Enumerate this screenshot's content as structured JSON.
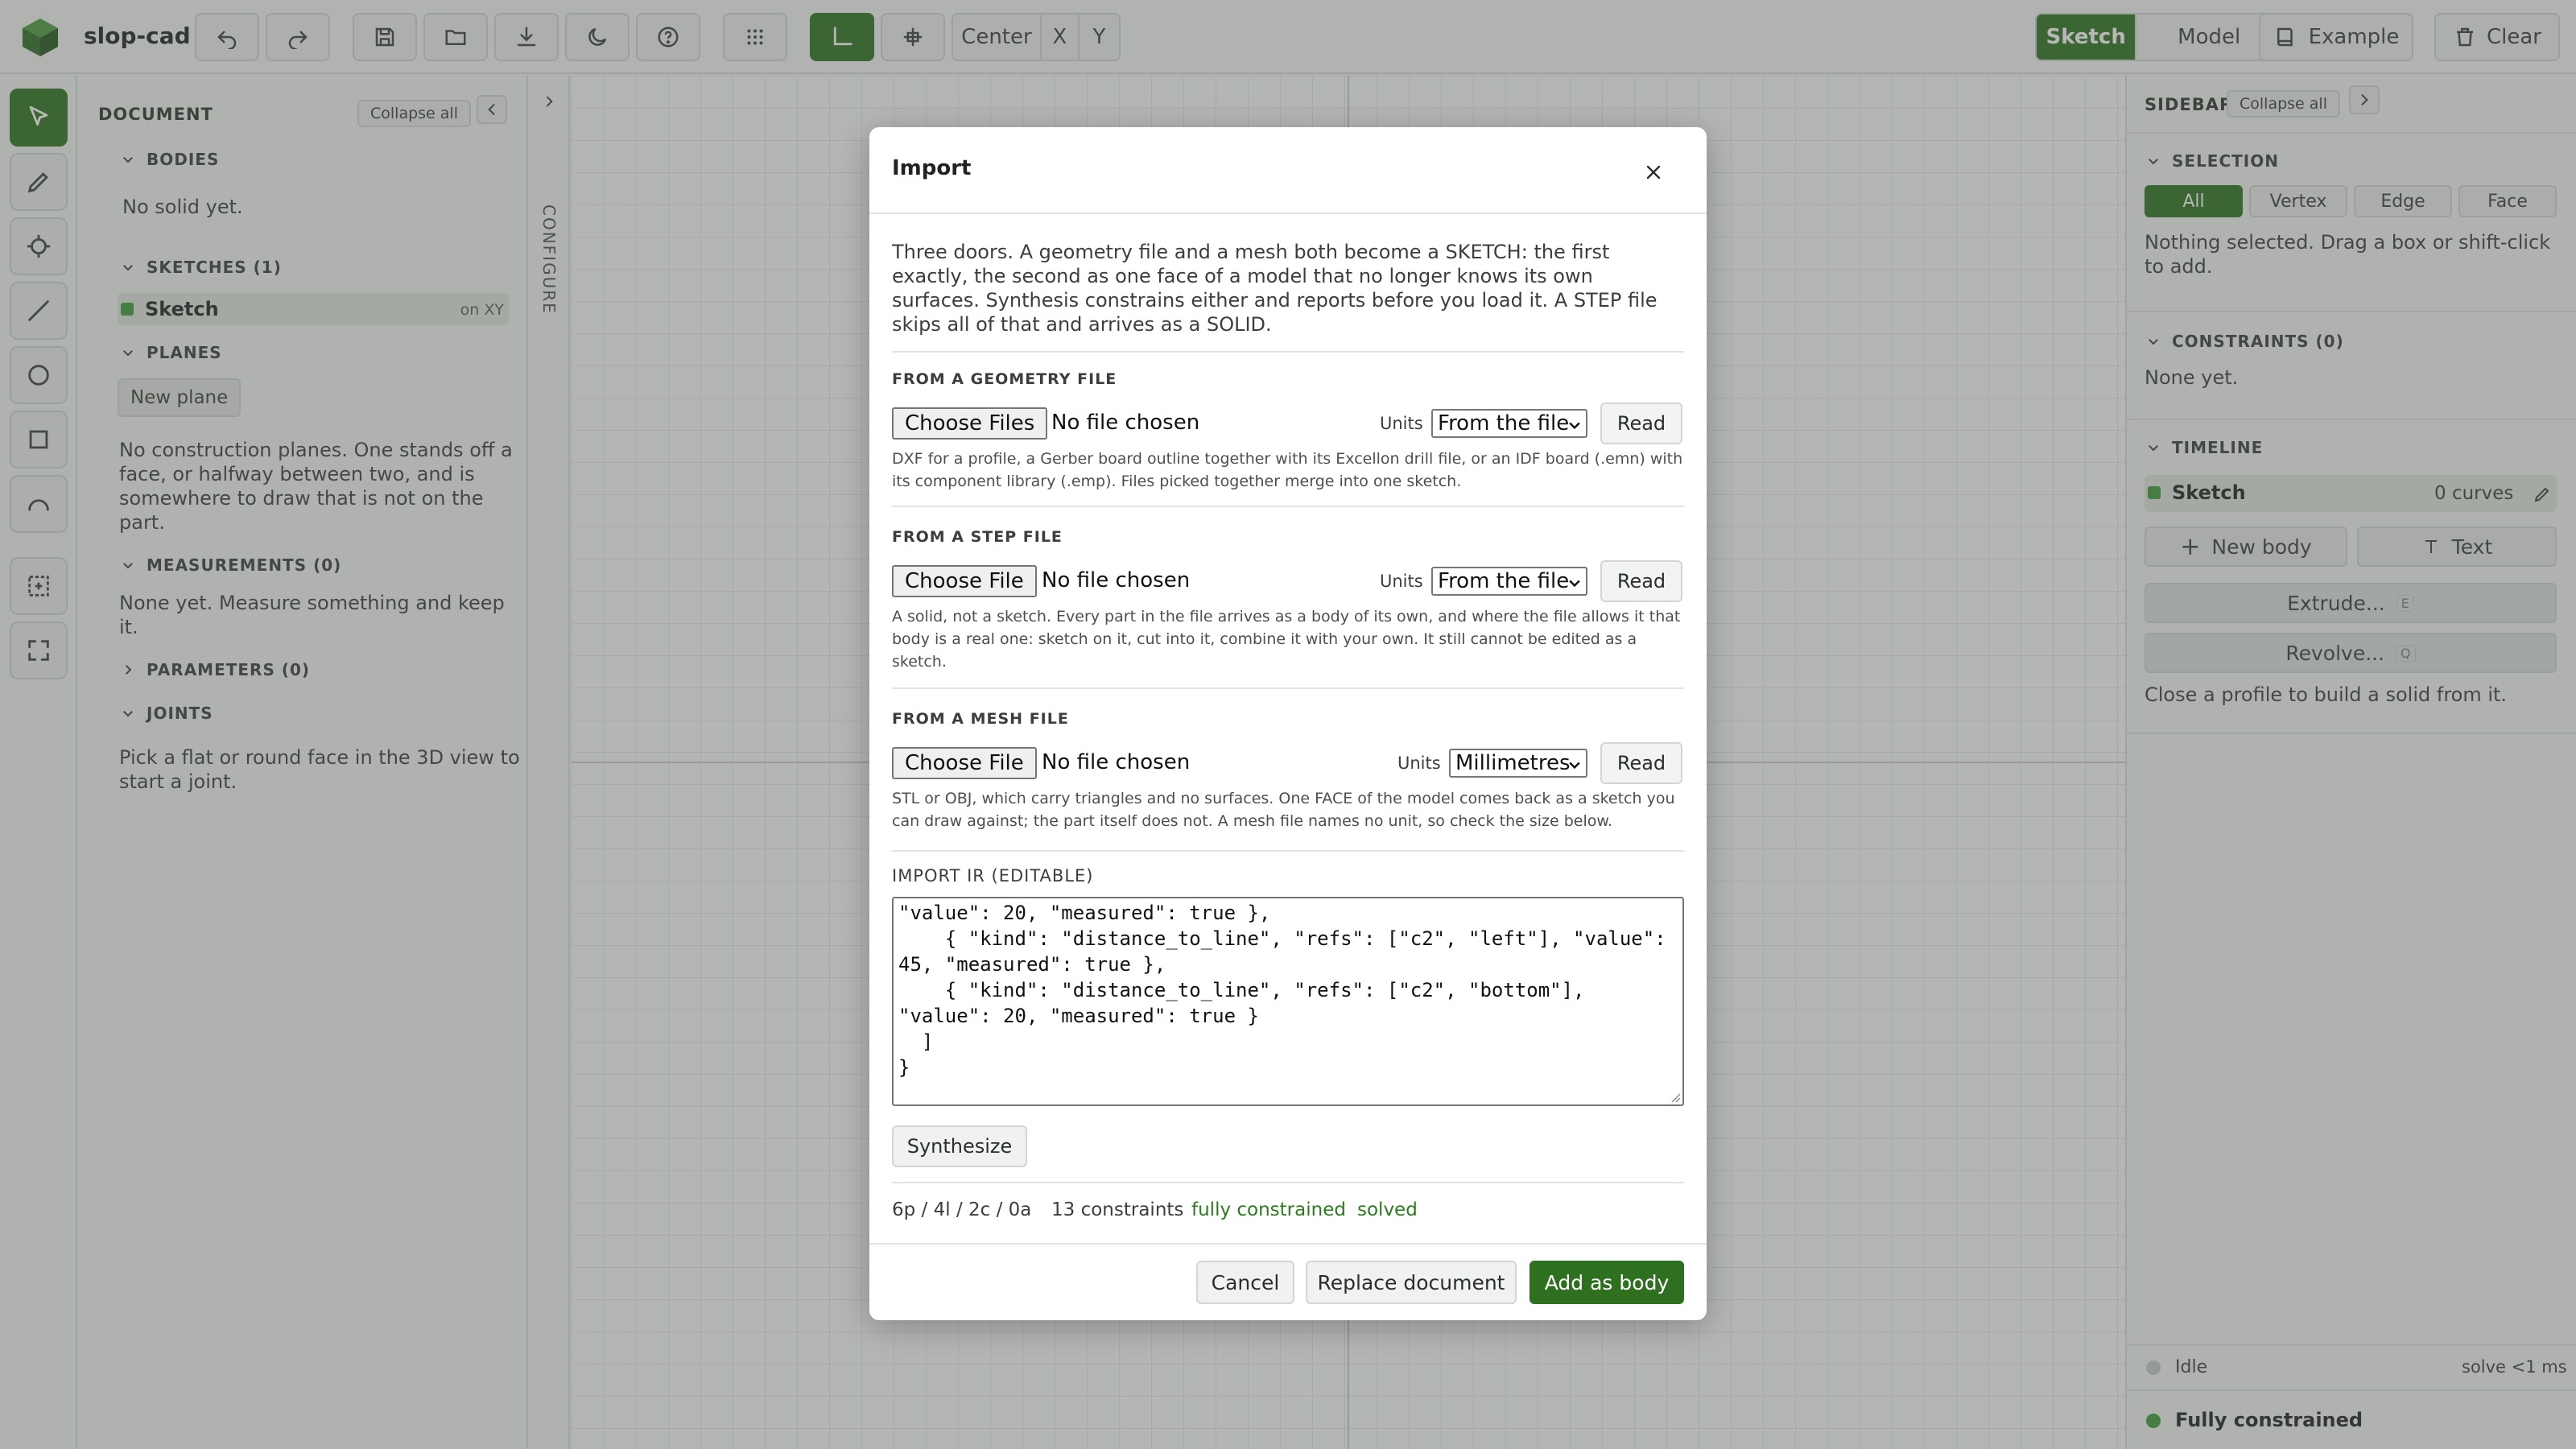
{
  "app": {
    "name": "slop-cad"
  },
  "toolbar": {
    "origin_buttons": [
      "Center",
      "X",
      "Y"
    ],
    "mode_tabs": [
      "Sketch",
      "Model"
    ],
    "example_label": "Example",
    "clear_label": "Clear"
  },
  "document": {
    "title": "DOCUMENT",
    "collapse_all": "Collapse all",
    "bodies_header": "BODIES",
    "bodies_empty": "No solid yet.",
    "sketches_header": "SKETCHES (1)",
    "sketch_name": "Sketch",
    "sketch_plane": "on XY",
    "planes_header": "PLANES",
    "new_plane": "New plane",
    "planes_text": [
      "No construction planes. One stands off a",
      "face, or halfway between two, and is",
      "somewhere to draw that is not on the",
      "part."
    ],
    "measurements_header": "MEASUREMENTS (0)",
    "measurements_text": [
      "None yet. Measure something and keep",
      "it."
    ],
    "parameters_header": "PARAMETERS (0)",
    "joints_header": "JOINTS",
    "joints_text": [
      "Pick a flat or round face in the 3D view to",
      "start a joint."
    ]
  },
  "configure": {
    "label": "CONFIGURE"
  },
  "sidebar": {
    "title": "SIDEBAR",
    "collapse_all": "Collapse all",
    "selection_header": "SELECTION",
    "filters": [
      "All",
      "Vertex",
      "Edge",
      "Face"
    ],
    "active_filter": "All",
    "selection_text": [
      "Nothing selected. Drag a box or shift-click",
      "to add."
    ],
    "constraints_header": "CONSTRAINTS (0)",
    "constraints_text": "None yet.",
    "timeline_header": "TIMELINE",
    "timeline_item": "Sketch",
    "timeline_count": "0 curves",
    "new_body": "New body",
    "text_btn": "Text",
    "extrude": "Extrude...",
    "extrude_key": "E",
    "revolve": "Revolve...",
    "revolve_key": "Q",
    "hint": "Close a profile to build a solid from it.",
    "status_idle": "Idle",
    "solve_time": "solve <1 ms",
    "status_constrained": "Fully constrained"
  },
  "modal": {
    "title": "Import",
    "intro": "Three doors. A geometry file and a mesh both become a SKETCH: the first exactly, the second as one face of a model that no longer knows its own surfaces. Synthesis constrains either and reports before you load it. A STEP file skips all of that and arrives as a SOLID.",
    "geometry": {
      "header": "FROM A GEOMETRY FILE",
      "file_button": "Choose Files",
      "no_file": "No file chosen",
      "units_label": "Units",
      "units_value": "From the file",
      "read": "Read",
      "help": "DXF for a profile, a Gerber board outline together with its Excellon drill file, or an IDF board (.emn) with its component library (.emp). Files picked together merge into one sketch."
    },
    "step": {
      "header": "FROM A STEP FILE",
      "file_button": "Choose File",
      "no_file": "No file chosen",
      "units_label": "Units",
      "units_value": "From the file",
      "read": "Read",
      "help": "A solid, not a sketch. Every part in the file arrives as a body of its own, and where the file allows it that body is a real one: sketch on it, cut into it, combine it with your own. It still cannot be edited as a sketch."
    },
    "mesh": {
      "header": "FROM A MESH FILE",
      "file_button": "Choose File",
      "no_file": "No file chosen",
      "units_label": "Units",
      "units_value": "Millimetres",
      "read": "Read",
      "help": "STL or OBJ, which carry triangles and no surfaces. One FACE of the model comes back as a sketch you can draw against; the part itself does not. A mesh file names no unit, so check the size below."
    },
    "ir_label": "IMPORT IR (EDITABLE)",
    "ir_text": "\"value\": 20, \"measured\": true },\n    { \"kind\": \"distance_to_line\", \"refs\": [\"c2\", \"left\"], \"value\": 45, \"measured\": true },\n    { \"kind\": \"distance_to_line\", \"refs\": [\"c2\", \"bottom\"], \"value\": 20, \"measured\": true }\n  ]\n}",
    "synthesize": "Synthesize",
    "status": {
      "counts": "6p / 4l / 2c / 0a",
      "constraints": "13 constraints",
      "constrained": "fully constrained",
      "solved": "solved"
    },
    "cancel": "Cancel",
    "replace": "Replace document",
    "add_body": "Add as body"
  },
  "colors": {
    "accent": "#2e7020",
    "status_green": "#3e9a3a",
    "ok_text": "#2f7a1f"
  }
}
